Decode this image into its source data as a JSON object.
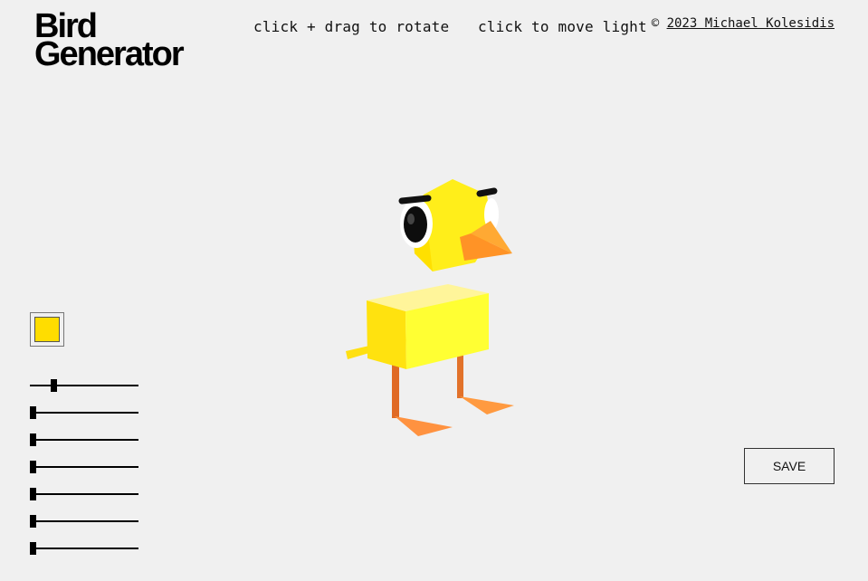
{
  "header": {
    "title_line1": "Bird",
    "title_line2": "Generator",
    "hint_rotate": "click + drag to rotate",
    "hint_light": "click to move light",
    "credit_symbol": "©",
    "credit_link": "2023 Michael Kolesidis"
  },
  "controls": {
    "color": "#ffdd00",
    "sliders": [
      {
        "value": 0.2
      },
      {
        "value": 0.0
      },
      {
        "value": 0.0
      },
      {
        "value": 0.0
      },
      {
        "value": 0.0
      },
      {
        "value": 0.0
      },
      {
        "value": 0.0
      }
    ],
    "save_label": "SAVE"
  },
  "colors": {
    "background": "#f0f0f0",
    "bird_yellow": "#ffee22",
    "beak_orange": "#ff9a2e",
    "legs_orange": "#e06a25"
  }
}
